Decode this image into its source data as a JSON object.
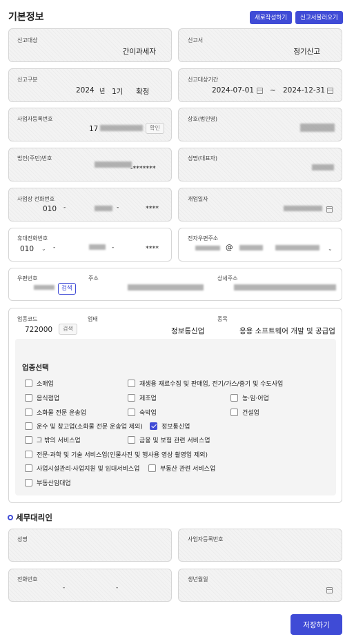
{
  "header": {
    "title": "기본정보",
    "new_button": "새로작성하기",
    "load_button": "신고서불러오기"
  },
  "fields": {
    "report_target": {
      "label": "신고대상",
      "value": "간이과세자"
    },
    "report_form": {
      "label": "신고서",
      "value": "정기신고"
    },
    "report_type": {
      "label": "신고구분",
      "year": "2024",
      "year_unit": "년",
      "period": "1기",
      "kind": "확정"
    },
    "report_period": {
      "label": "신고대상기간",
      "start": "2024-07-01",
      "sep": "~",
      "end": "2024-12-31"
    },
    "biz_reg_no": {
      "label": "사업자등록번호",
      "value_prefix": "17",
      "confirm_button": "확인"
    },
    "company_name": {
      "label": "상호(법인명)"
    },
    "corp_no": {
      "label": "법인(주민)번호",
      "masked": "-*******"
    },
    "rep_name": {
      "label": "성명(대표자)"
    },
    "biz_phone": {
      "label": "사업장 전화번호",
      "area": "010",
      "dash1": "-",
      "dash2": "-",
      "masked": "****"
    },
    "open_date": {
      "label": "개업일자"
    },
    "mobile": {
      "label": "휴대전화번호",
      "area": "010",
      "dash1": "-",
      "dash2": "-",
      "masked": "****"
    },
    "email": {
      "label": "전자우편주소",
      "at": "@"
    },
    "address": {
      "zip_label": "우편번호",
      "search_button": "검색",
      "addr_label": "주소",
      "detail_label": "상세주소"
    },
    "industry": {
      "code_label": "업종코드",
      "code": "722000",
      "search_button": "검색",
      "type_label": "업태",
      "type_value": "정보통신업",
      "item_label": "종목",
      "item_value": "응용 소프트웨어 개발 및 공급업"
    }
  },
  "industry_select": {
    "title": "업종선택",
    "options": [
      {
        "label": "소매업",
        "checked": false
      },
      {
        "label": "재생용 재료수집 및 판매업, 전기/가스/증기 및 수도사업",
        "checked": false
      },
      {
        "label": "음식점업",
        "checked": false
      },
      {
        "label": "제조업",
        "checked": false
      },
      {
        "label": "농·임·어업",
        "checked": false
      },
      {
        "label": "소화물 전문 운송업",
        "checked": false
      },
      {
        "label": "숙박업",
        "checked": false
      },
      {
        "label": "건설업",
        "checked": false
      },
      {
        "label": "운수 및 창고업(소화물 전문 운송업 제외)",
        "checked": false
      },
      {
        "label": "정보통신업",
        "checked": true
      },
      {
        "label": "그 밖의 서비스업",
        "checked": false
      },
      {
        "label": "금융 및 보험 관련 서비스업",
        "checked": false
      },
      {
        "label": "전문·과학 및 기술 서비스업(인물사진 및 행사용 영상 촬영업 제외)",
        "checked": false
      },
      {
        "label": "사업시설관리·사업지원 및 임대서비스업",
        "checked": false
      },
      {
        "label": "부동산 관련 서비스업",
        "checked": false
      },
      {
        "label": "부동산임대업",
        "checked": false
      }
    ]
  },
  "agent": {
    "title": "세무대리인",
    "name_label": "성명",
    "biz_no_label": "사업자등록번호",
    "phone_label": "전화번호",
    "phone_dash1": "-",
    "phone_dash2": "-",
    "birth_label": "생년월일"
  },
  "save_button": "저장하기",
  "colors": {
    "accent": "#3f4bd6"
  }
}
